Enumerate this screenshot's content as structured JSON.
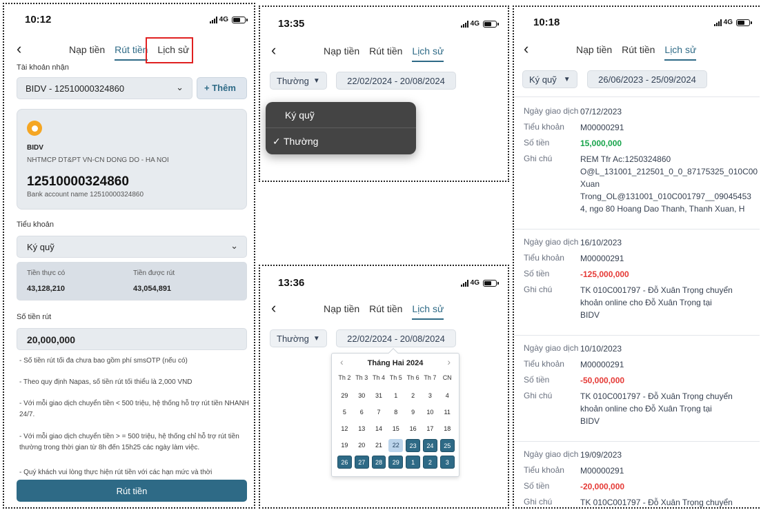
{
  "colors": {
    "accent": "#2e6a86",
    "positive": "#16a34a",
    "negative": "#e53935",
    "highlight_box": "#e02020"
  },
  "p1": {
    "time": "10:12",
    "network": "4G",
    "tabs": [
      "Nạp tiền",
      "Rút tiền",
      "Lịch sử"
    ],
    "receive_label": "Tài khoản nhận",
    "account_select": "BIDV - 12510000324860",
    "add_button": "+ Thêm",
    "bank_short": "BIDV",
    "bank_full": "NHTMCP DT&PT VN-CN DONG DO - HA NOI",
    "account_number": "12510000324860",
    "account_name": "Bank account name 12510000324860",
    "subaccount_label": "Tiểu khoản",
    "subaccount_value": "Ký quỹ",
    "actual_label": "Tiền thực có",
    "actual_value": "43,128,210",
    "withdrawable_label": "Tiền được rút",
    "withdrawable_value": "43,054,891",
    "amount_label": "Số tiền rút",
    "amount_value": "20,000,000",
    "notes": [
      "- Số tiền rút tối đa chưa bao gồm phí smsOTP (nếu có)",
      "- Theo quy định Napas, số tiền rút tối thiểu là 2,000 VND",
      "- Với mỗi giao dịch chuyển tiền < 500 triệu, hệ thống hỗ trợ rút tiền NHANH 24/7.",
      "- Với mỗi giao dịch chuyển tiền > = 500 triệu, hệ thống chỉ hỗ trợ rút tiền thường trong thời gian từ 8h đến 15h25 các ngày làm việc.",
      "- Quý khách vui lòng thực hiện rút tiền với các hạn mức và thời"
    ],
    "submit": "Rút tiền"
  },
  "p2": {
    "time": "13:35",
    "network": "4G",
    "tabs": [
      "Nạp tiền",
      "Rút tiền",
      "Lịch sử"
    ],
    "type_chip": "Thường",
    "date_chip": "22/02/2024 - 20/08/2024",
    "menu": [
      "Ký quỹ",
      "Thường"
    ],
    "check": "✓"
  },
  "p3": {
    "time": "13:36",
    "network": "4G",
    "tabs": [
      "Nạp tiền",
      "Rút tiền",
      "Lịch sử"
    ],
    "type_chip": "Thường",
    "date_chip": "22/02/2024 - 20/08/2024",
    "month": "Tháng Hai 2024",
    "weekdays": [
      "Th 2",
      "Th 3",
      "Th 4",
      "Th 5",
      "Th 6",
      "Th 7",
      "CN"
    ],
    "weeks": [
      [
        "29",
        "30",
        "31",
        "1",
        "2",
        "3",
        "4"
      ],
      [
        "5",
        "6",
        "7",
        "8",
        "9",
        "10",
        "11"
      ],
      [
        "12",
        "13",
        "14",
        "15",
        "16",
        "17",
        "18"
      ],
      [
        "19",
        "20",
        "21",
        "22",
        "23",
        "24",
        "25"
      ],
      [
        "26",
        "27",
        "28",
        "29",
        "1",
        "2",
        "3"
      ]
    ],
    "range_start": "22"
  },
  "p4": {
    "time": "10:18",
    "network": "4G",
    "tabs": [
      "Nạp tiền",
      "Rút tiền",
      "Lịch sử"
    ],
    "type_chip": "Ký quỹ",
    "date_chip": "26/06/2023 - 25/09/2024",
    "field_labels": {
      "date": "Ngày giao dịch",
      "sub": "Tiểu khoản",
      "amount": "Số tiền",
      "note": "Ghi chú"
    },
    "transactions": [
      {
        "date": "07/12/2023",
        "sub": "M00000291",
        "amount": "15,000,000",
        "positive": true,
        "note": [
          "REM Tfr Ac:1250324860",
          "O@L_131001_212501_0_0_87175325_010C00",
          "Xuan",
          "Trong_OL@131001_010C001797__09045453",
          "4, ngo 80 Hoang Dao Thanh, Thanh Xuan, H"
        ]
      },
      {
        "date": "16/10/2023",
        "sub": "M00000291",
        "amount": "-125,000,000",
        "positive": false,
        "note": [
          "TK 010C001797 - Đỗ Xuân Trọng chuyển",
          "khoản online cho Đỗ Xuân Trọng tại",
          "BIDV"
        ]
      },
      {
        "date": "10/10/2023",
        "sub": "M00000291",
        "amount": "-50,000,000",
        "positive": false,
        "note": [
          "TK 010C001797 - Đỗ Xuân Trọng chuyển",
          "khoản online cho Đỗ Xuân Trọng tại",
          "BIDV"
        ]
      },
      {
        "date": "19/09/2023",
        "sub": "M00000291",
        "amount": "-20,000,000",
        "positive": false,
        "note": [
          "TK 010C001797 - Đỗ Xuân Trọng chuyển"
        ]
      }
    ]
  }
}
